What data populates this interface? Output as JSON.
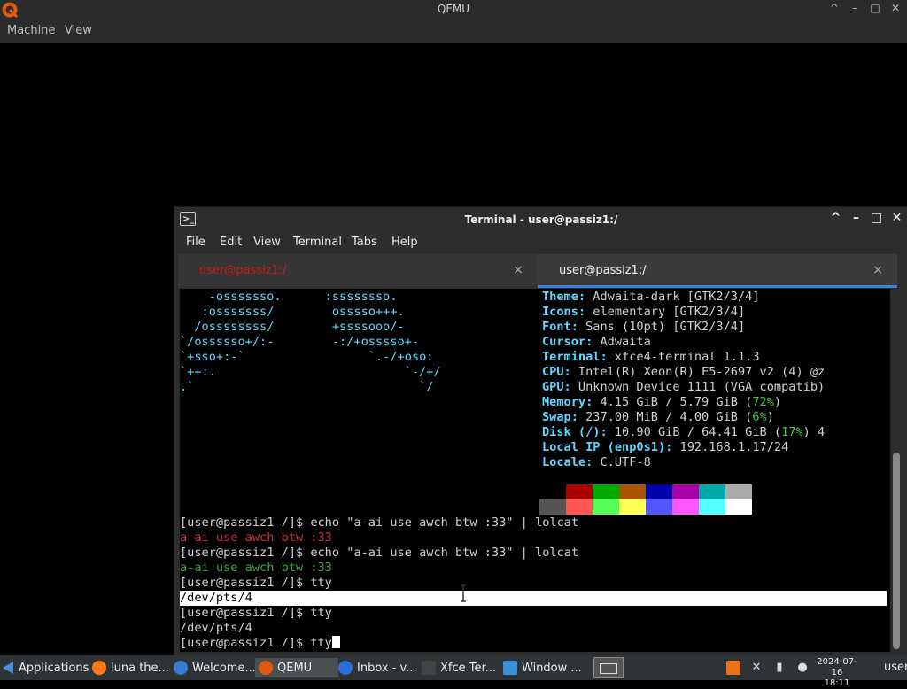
{
  "qemu": {
    "title": "QEMU",
    "menu": [
      "Machine",
      "View"
    ],
    "controls": [
      "^",
      "–",
      "□",
      "✕"
    ]
  },
  "terminal": {
    "title": "Terminal - user@passiz1:/",
    "icon": "terminal-icon",
    "controls": [
      "^",
      "–",
      "□",
      "✕"
    ],
    "menu": [
      "File",
      "Edit",
      "View",
      "Terminal",
      "Tabs",
      "Help"
    ],
    "tabs": [
      {
        "label": "user@passiz1:/",
        "close": "×",
        "active": false,
        "color": "#cc1818"
      },
      {
        "label": "user@passiz1:/",
        "close": "×",
        "active": true
      }
    ],
    "ascii_art": [
      "    -osssssso.      :ssssssso.",
      "   :osssssss/        osssso+++.",
      "  /ossssssss/        +ssssooo/-",
      "`/ossssso+/:-        -:/+osssso+-",
      "`+sso+:-`                 `.-/+oso:",
      "`++:.                          `-/+/",
      ".`                               `/"
    ],
    "neofetch": [
      {
        "key": "Theme:",
        "value": " Adwaita-dark [GTK2/3/4]"
      },
      {
        "key": "Icons:",
        "value": " elementary [GTK2/3/4]"
      },
      {
        "key": "Font:",
        "value": " Sans (10pt) [GTK2/3/4]"
      },
      {
        "key": "Cursor:",
        "value": " Adwaita"
      },
      {
        "key": "Terminal:",
        "value": " xfce4-terminal 1.1.3"
      },
      {
        "key": "CPU:",
        "value": " Intel(R) Xeon(R) E5-2697 v2 (4) @z"
      },
      {
        "key": "GPU:",
        "value": " Unknown Device 1111 (VGA compatib)"
      },
      {
        "key": "Memory:",
        "value": " 4.15 GiB / 5.79 GiB (",
        "pct": "72%",
        "tail": ")"
      },
      {
        "key": "Swap:",
        "value": " 237.00 MiB / 4.00 GiB (",
        "pct": "6%",
        "tail": ")"
      },
      {
        "key": "Disk (/):",
        "value": " 10.90 GiB / 64.41 GiB (",
        "pct": "17%",
        "tail": ") 4"
      },
      {
        "key": "Local IP (enp0s1):",
        "value": " 192.168.1.17/24"
      },
      {
        "key": "Locale:",
        "value": " C.UTF-8"
      }
    ],
    "palette_top": [
      "#000000",
      "#aa0000",
      "#00aa00",
      "#aa5500",
      "#0000aa",
      "#aa00aa",
      "#00aaaa",
      "#aaaaaa"
    ],
    "palette_bottom": [
      "#555555",
      "#ff5555",
      "#55ff55",
      "#ffff55",
      "#5555ff",
      "#ff55ff",
      "#55ffff",
      "#ffffff"
    ],
    "lines": [
      "[user@passiz1 /]$ echo \"a-ai use awch btw :33\" | lolcat",
      "a-ai use awch btw :33",
      "[user@passiz1 /]$ echo \"a-ai use awch btw :33\" | lolcat",
      "a-ai use awch btw :33",
      "[user@passiz1 /]$ tty",
      "/dev/pts/4",
      "[user@passiz1 /]$ tty",
      "/dev/pts/4",
      "[user@passiz1 /]$ tty"
    ]
  },
  "taskbar": {
    "apps_label": "Applications",
    "items": [
      {
        "label": "luna the...",
        "icon": "firefox-icon",
        "color": "#ff7a1a"
      },
      {
        "label": "Welcome...",
        "icon": "globe-icon",
        "color": "#3a7bd5"
      },
      {
        "label": "QEMU",
        "icon": "qemu-icon",
        "color": "#e05a10"
      },
      {
        "label": "Inbox - v...",
        "icon": "thunderbird-icon",
        "color": "#2a6fdb"
      },
      {
        "label": "Xfce Ter...",
        "icon": "terminal-icon",
        "color": "#444444"
      },
      {
        "label": "Window ...",
        "icon": "window-icon",
        "color": "#3a8fd6"
      }
    ],
    "clock_date": "2024-07-16",
    "clock_time": "18:11",
    "user": "user"
  }
}
